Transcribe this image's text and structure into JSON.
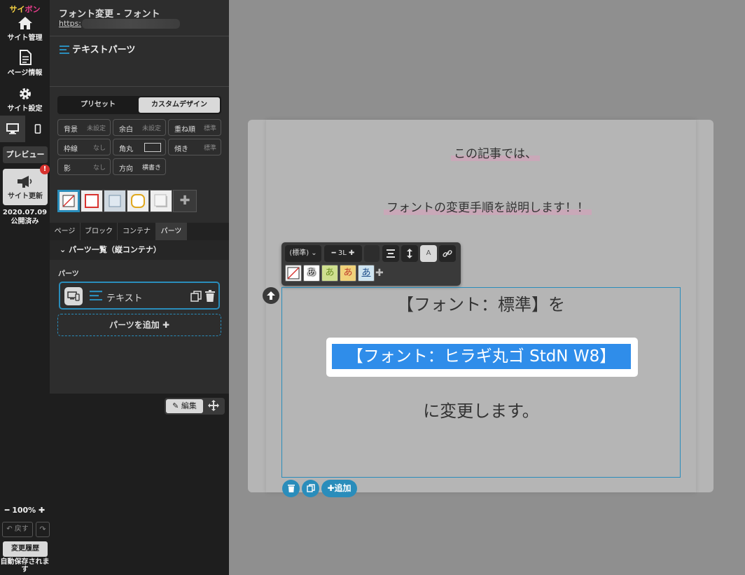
{
  "rail": {
    "logo": "サイボン",
    "site_manage": "サイト管理",
    "page_info": "ページ情報",
    "site_settings": "サイト設定",
    "preview": "プレビュー",
    "site_update": "サイト更新",
    "badge": "!",
    "publish_date": "2020.07.09",
    "publish_status": "公開済み",
    "zoom": "100%",
    "undo": "戻す",
    "history": "変更履歴",
    "autosave": "自動保存されます"
  },
  "panel": {
    "page_title": "フォント変更 - フォント",
    "page_url": "https:",
    "part_title": "テキストパーツ",
    "preset": "プリセット",
    "custom_design": "カスタムデザイン",
    "options": {
      "bg_k": "背景",
      "bg_v": "未設定",
      "margin_k": "余白",
      "margin_v": "未設定",
      "stack_k": "重ね順",
      "stack_v": "標準",
      "border_k": "枠線",
      "border_v": "なし",
      "radius_k": "角丸",
      "tilt_k": "傾き",
      "tilt_v": "標準",
      "shadow_k": "影",
      "shadow_v": "なし",
      "dir_k": "方向",
      "dir_v": "横書き"
    },
    "tabs": [
      "ページ",
      "ブロック",
      "コンテナ",
      "パーツ"
    ],
    "parts_list_head": "パーツ一覧（縦コンテナ）",
    "parts_label": "パーツ",
    "part_item_label": "テキスト",
    "add_part": "パーツを追加",
    "edit": "編集"
  },
  "canvas": {
    "line1": "この記事では、",
    "line2": "フォントの変更手順を説明します！！",
    "toolbar": {
      "font_select": "(標準)",
      "size": "3L",
      "a_label": "A",
      "font_glyph": "あ"
    },
    "t1": "【フォント：標準】を",
    "t2": "【フォント：ヒラギ丸ゴ StdN W8】",
    "t3": "に変更します。",
    "add": "追加"
  },
  "colors": {
    "accent": "#2a8dbb",
    "selection": "#2f8dea",
    "badge": "#d8322e",
    "logo_pink": "#e83e8c",
    "logo_yellow": "#f5d142"
  }
}
